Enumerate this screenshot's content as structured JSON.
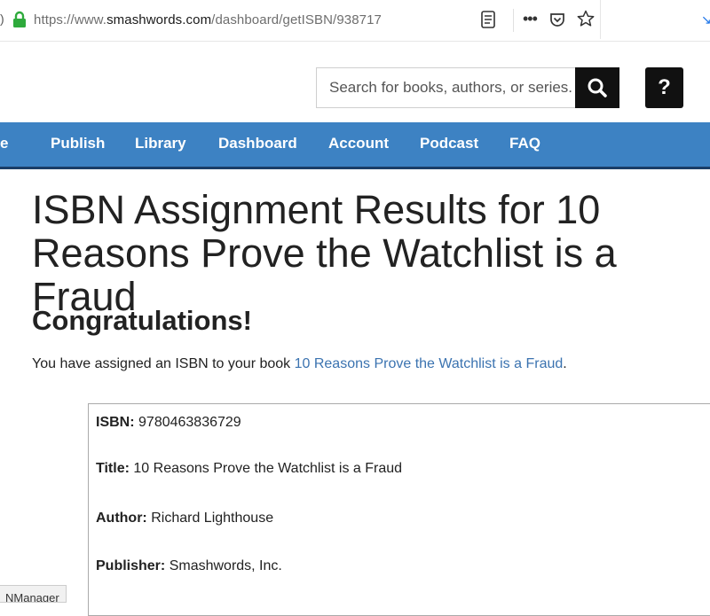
{
  "browser": {
    "left_edge_glyph": ")",
    "url_prefix": "https://www.",
    "url_domain": "smashwords.com",
    "url_path": "/dashboard/getISBN/938717",
    "menu_dots": "•••",
    "download_glyph": "↘"
  },
  "header": {
    "search_placeholder": "Search for books, authors, or series.",
    "help_label": "?"
  },
  "nav": {
    "items": [
      "e",
      "Publish",
      "Library",
      "Dashboard",
      "Account",
      "Podcast",
      "FAQ"
    ]
  },
  "main": {
    "title": "ISBN Assignment Results for 10 Reasons Prove the Watchlist is a Fraud",
    "congrats": "Congratulations!",
    "assigned_prefix": "You have assigned an ISBN to your book ",
    "book_link": "10 Reasons Prove the Watchlist is a Fraud",
    "assigned_suffix": "."
  },
  "details": {
    "isbn_label": "ISBN:",
    "isbn_value": "9780463836729",
    "title_label": "Title:",
    "title_value": "10 Reasons Prove the Watchlist is a Fraud",
    "author_label": "Author:",
    "author_value": "Richard Lighthouse",
    "publisher_label": "Publisher:",
    "publisher_value": "Smashwords, Inc."
  },
  "bottom_tab": "NManager",
  "colors": {
    "nav_bg": "#3d82c3",
    "link": "#3b73b0",
    "lock": "#2eaa3c"
  }
}
